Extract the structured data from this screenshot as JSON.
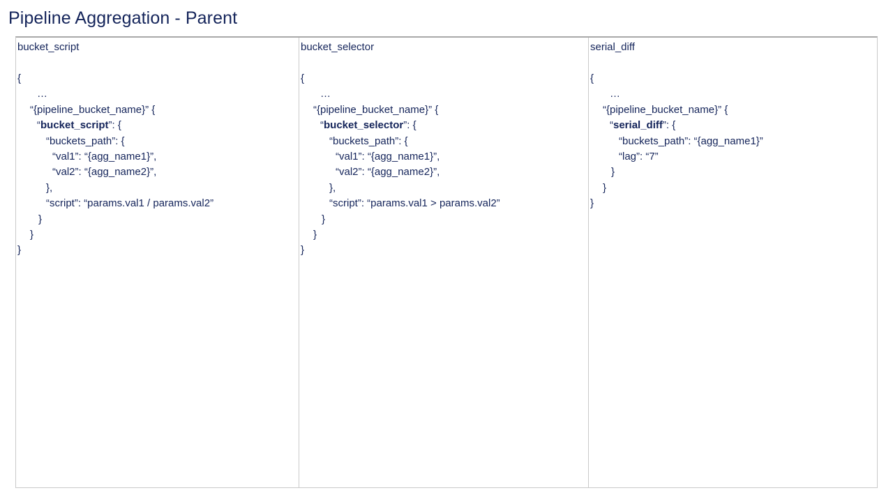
{
  "page": {
    "title": "Pipeline Aggregation - Parent"
  },
  "columns": [
    {
      "header": "bucket_script",
      "lines": [
        {
          "indent": 0,
          "parts": [
            {
              "t": "{",
              "b": false
            }
          ]
        },
        {
          "indent": 28,
          "parts": [
            {
              "t": "…",
              "b": false
            }
          ]
        },
        {
          "indent": 18,
          "parts": [
            {
              "t": "“{pipeline_bucket_name}” {",
              "b": false
            }
          ]
        },
        {
          "indent": 28,
          "parts": [
            {
              "t": "“",
              "b": false
            },
            {
              "t": "bucket_script",
              "b": true
            },
            {
              "t": "”: {",
              "b": false
            }
          ]
        },
        {
          "indent": 41,
          "parts": [
            {
              "t": "“buckets_path”: {",
              "b": false
            }
          ]
        },
        {
          "indent": 50,
          "parts": [
            {
              "t": "“val1”: “{agg_name1}”,",
              "b": false
            }
          ]
        },
        {
          "indent": 50,
          "parts": [
            {
              "t": "“val2”: “{agg_name2}”,",
              "b": false
            }
          ]
        },
        {
          "indent": 41,
          "parts": [
            {
              "t": "},",
              "b": false
            }
          ]
        },
        {
          "indent": 41,
          "parts": [
            {
              "t": "“script”: “params.val1 / params.val2”",
              "b": false
            }
          ]
        },
        {
          "indent": 30,
          "parts": [
            {
              "t": "}",
              "b": false
            }
          ]
        },
        {
          "indent": 18,
          "parts": [
            {
              "t": "}",
              "b": false
            }
          ]
        },
        {
          "indent": 0,
          "parts": [
            {
              "t": "}",
              "b": false
            }
          ]
        }
      ]
    },
    {
      "header": "bucket_selector",
      "lines": [
        {
          "indent": 0,
          "parts": [
            {
              "t": "{",
              "b": false
            }
          ]
        },
        {
          "indent": 28,
          "parts": [
            {
              "t": "…",
              "b": false
            }
          ]
        },
        {
          "indent": 18,
          "parts": [
            {
              "t": "“{pipeline_bucket_name}” {",
              "b": false
            }
          ]
        },
        {
          "indent": 28,
          "parts": [
            {
              "t": "“",
              "b": false
            },
            {
              "t": "bucket_selector",
              "b": true
            },
            {
              "t": "”: {",
              "b": false
            }
          ]
        },
        {
          "indent": 41,
          "parts": [
            {
              "t": "“buckets_path”: {",
              "b": false
            }
          ]
        },
        {
          "indent": 50,
          "parts": [
            {
              "t": "“val1”: “{agg_name1}”,",
              "b": false
            }
          ]
        },
        {
          "indent": 50,
          "parts": [
            {
              "t": "“val2”: “{agg_name2}”,",
              "b": false
            }
          ]
        },
        {
          "indent": 41,
          "parts": [
            {
              "t": "},",
              "b": false
            }
          ]
        },
        {
          "indent": 41,
          "parts": [
            {
              "t": "“script”: “params.val1 > params.val2”",
              "b": false
            }
          ]
        },
        {
          "indent": 30,
          "parts": [
            {
              "t": "}",
              "b": false
            }
          ]
        },
        {
          "indent": 18,
          "parts": [
            {
              "t": "}",
              "b": false
            }
          ]
        },
        {
          "indent": 0,
          "parts": [
            {
              "t": "}",
              "b": false
            }
          ]
        }
      ]
    },
    {
      "header": "serial_diff",
      "lines": [
        {
          "indent": 0,
          "parts": [
            {
              "t": "{",
              "b": false
            }
          ]
        },
        {
          "indent": 28,
          "parts": [
            {
              "t": "…",
              "b": false
            }
          ]
        },
        {
          "indent": 18,
          "parts": [
            {
              "t": "“{pipeline_bucket_name}” {",
              "b": false
            }
          ]
        },
        {
          "indent": 28,
          "parts": [
            {
              "t": "“",
              "b": false
            },
            {
              "t": "serial_diff",
              "b": true
            },
            {
              "t": "”: {",
              "b": false
            }
          ]
        },
        {
          "indent": 41,
          "parts": [
            {
              "t": "“buckets_path”: “{agg_name1}”",
              "b": false
            }
          ]
        },
        {
          "indent": 41,
          "parts": [
            {
              "t": "“lag”: “7”",
              "b": false
            }
          ]
        },
        {
          "indent": 30,
          "parts": [
            {
              "t": "}",
              "b": false
            }
          ]
        },
        {
          "indent": 18,
          "parts": [
            {
              "t": "}",
              "b": false
            }
          ]
        },
        {
          "indent": 0,
          "parts": [
            {
              "t": "}",
              "b": false
            }
          ]
        }
      ]
    }
  ]
}
